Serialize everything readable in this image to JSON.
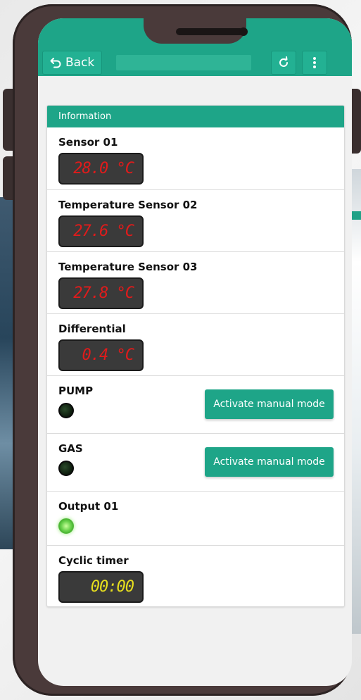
{
  "appbar": {
    "back_label": "Back",
    "refresh_icon": "refresh-icon",
    "menu_icon": "more-vertical-icon"
  },
  "panel": {
    "title": "Information",
    "sensors": [
      {
        "label": "Sensor 01",
        "value": "28.0 °C"
      },
      {
        "label": "Temperature Sensor 02",
        "value": "27.6 °C"
      },
      {
        "label": "Temperature Sensor 03",
        "value": "27.8 °C"
      },
      {
        "label": "Differential",
        "value": "0.4 °C"
      }
    ],
    "outputs": [
      {
        "label": "PUMP",
        "state": "off",
        "button": "Activate manual mode"
      },
      {
        "label": "GAS",
        "state": "off",
        "button": "Activate manual mode"
      },
      {
        "label": "Output 01",
        "state": "on"
      }
    ],
    "timer": {
      "label": "Cyclic timer",
      "value": "00:00"
    }
  },
  "colors": {
    "accent": "#1ea588",
    "display_red": "#e01b1b",
    "display_yellow": "#e7df1e",
    "led_on": "#67d04a"
  }
}
